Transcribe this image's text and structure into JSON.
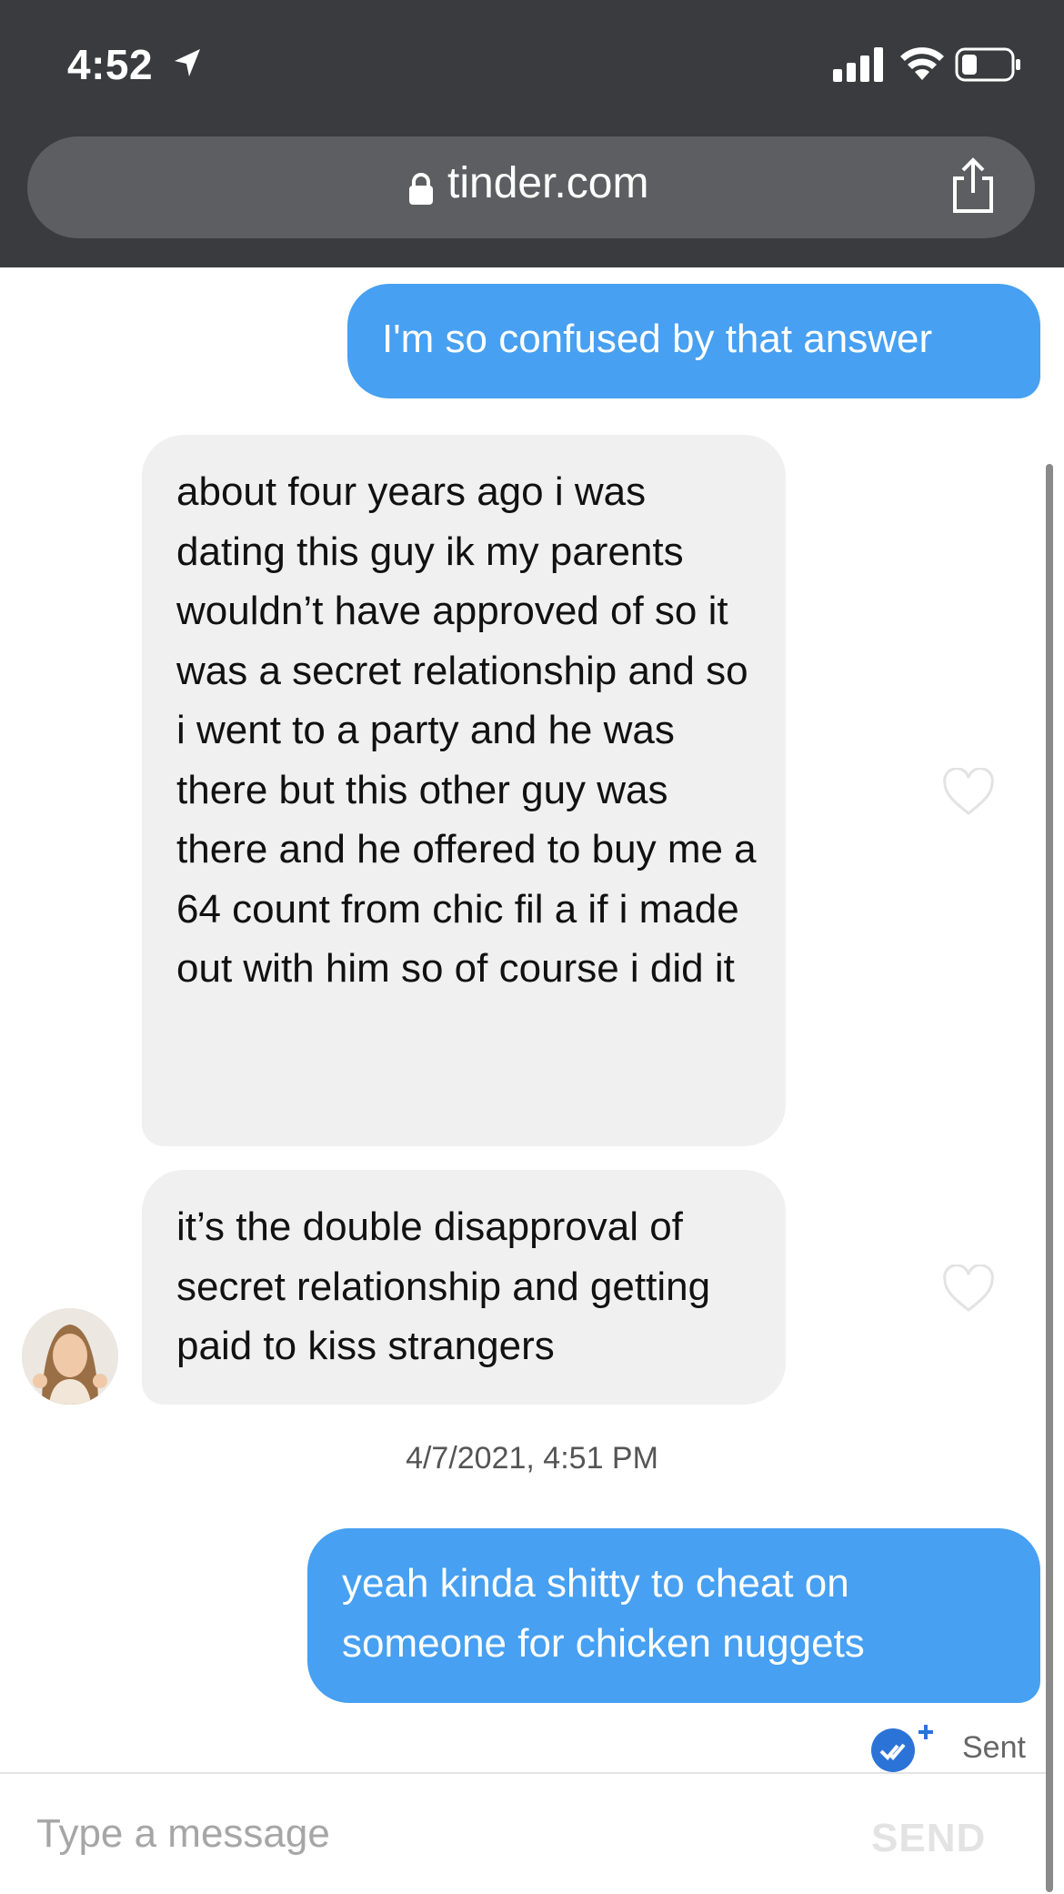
{
  "status_bar": {
    "time": "4:52"
  },
  "browser": {
    "url": "tinder.com"
  },
  "messages": [
    {
      "direction": "outgoing",
      "text": "I'm so confused by that answer"
    },
    {
      "direction": "incoming",
      "text": "about four years ago i was dating this guy ik my parents wouldn’t have approved of so it was a secret relationship and so i went to a party and he was there but this other guy was there and he offered to buy me a 64 count from chic fil a if i made out with him so of course i did it"
    },
    {
      "direction": "incoming",
      "text": "it’s the double disapproval of secret relationship and getting paid to kiss strangers"
    },
    {
      "direction": "outgoing",
      "text": "yeah kinda shitty to cheat on someone for chicken nuggets"
    }
  ],
  "timestamp": "4/7/2021, 4:51 PM",
  "delivery_status": "Sent",
  "composer": {
    "placeholder": "Type a message",
    "send_label": "SEND"
  },
  "colors": {
    "accent": "#47a0f1",
    "incoming_bubble": "#f0f0f0",
    "chrome": "#3a3b3e"
  }
}
